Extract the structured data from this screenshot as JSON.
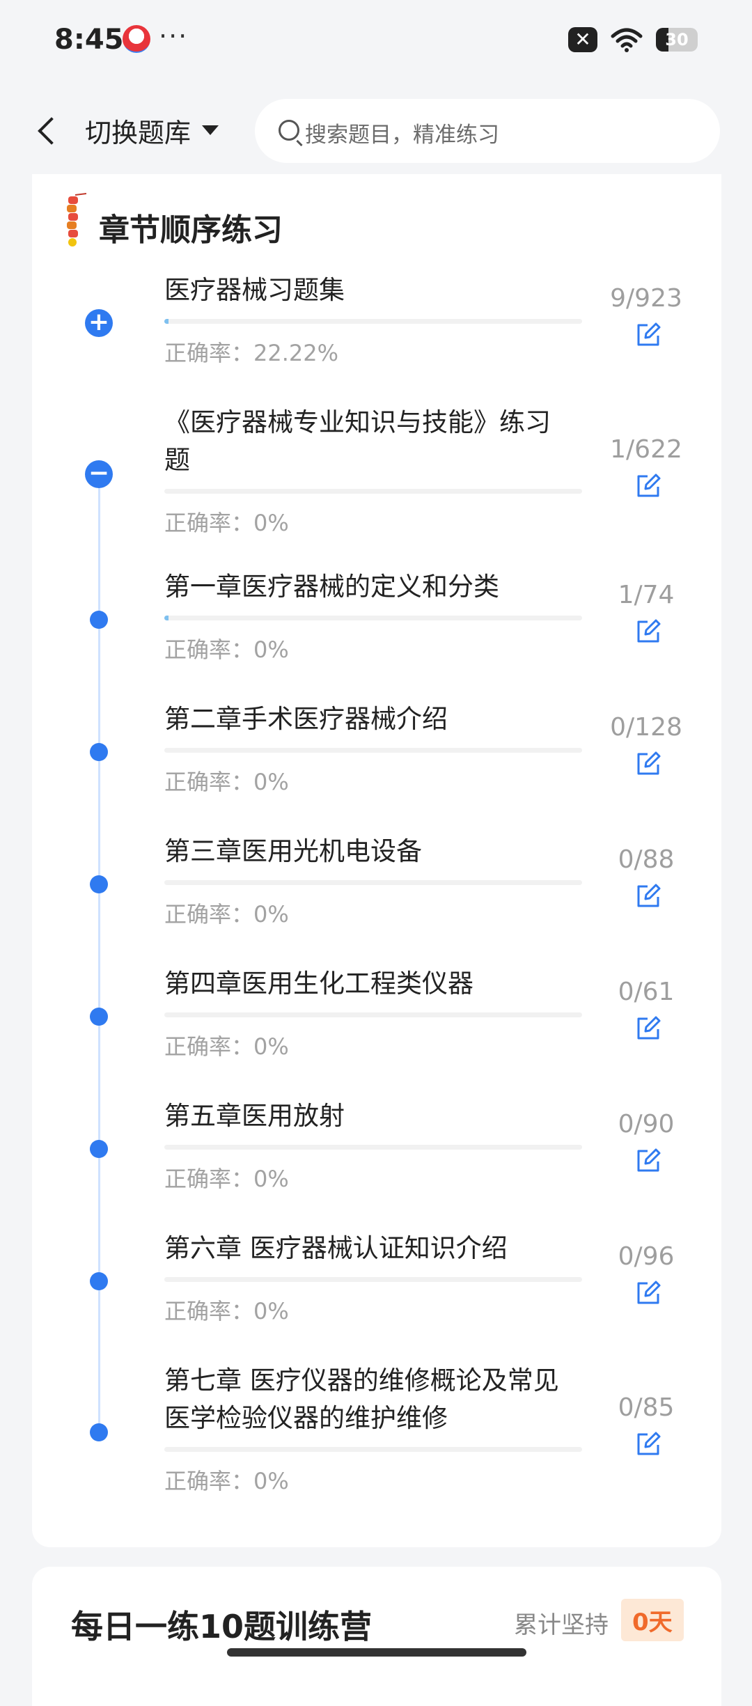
{
  "status_bar": {
    "time": "8:45",
    "more": "···",
    "battery": "30",
    "close_icon": "x-icon"
  },
  "nav": {
    "title": "切换题库",
    "search_placeholder": "搜索题目，精准练习"
  },
  "chapter_section": {
    "title": "章节顺序练习",
    "items": [
      {
        "title": "医疗器械习题集",
        "accuracy": "正确率：22.22%",
        "count": "9/923",
        "progress": 0.01,
        "marker": "plus"
      },
      {
        "title": "《医疗器械专业知识与技能》练习题",
        "accuracy": "正确率：0%",
        "count": "1/622",
        "progress": 0.0,
        "marker": "minus"
      },
      {
        "title": "第一章医疗器械的定义和分类",
        "accuracy": "正确率：0%",
        "count": "1/74",
        "progress": 0.01,
        "marker": "dot"
      },
      {
        "title": "第二章手术医疗器械介绍",
        "accuracy": "正确率：0%",
        "count": "0/128",
        "progress": 0.0,
        "marker": "dot"
      },
      {
        "title": "第三章医用光机电设备",
        "accuracy": "正确率：0%",
        "count": "0/88",
        "progress": 0.0,
        "marker": "dot"
      },
      {
        "title": "第四章医用生化工程类仪器",
        "accuracy": "正确率：0%",
        "count": "0/61",
        "progress": 0.0,
        "marker": "dot"
      },
      {
        "title": "第五章医用放射",
        "accuracy": "正确率：0%",
        "count": "0/90",
        "progress": 0.0,
        "marker": "dot"
      },
      {
        "title": "第六章 医疗器械认证知识介绍",
        "accuracy": "正确率：0%",
        "count": "0/96",
        "progress": 0.0,
        "marker": "dot"
      },
      {
        "title": "第七章 医疗仪器的维修概论及常见医学检验仪器的维护维修",
        "accuracy": "正确率：0%",
        "count": "0/85",
        "progress": 0.0,
        "marker": "dot"
      }
    ]
  },
  "daily_camp": {
    "title": "每日一练10题训练营",
    "persist_label": "累计坚持",
    "days": "0天"
  },
  "colors": {
    "accent": "#2f7af0",
    "progress": "#7ec0ef",
    "badge_bg": "#fde8d6",
    "badge_text": "#f06a2b"
  }
}
